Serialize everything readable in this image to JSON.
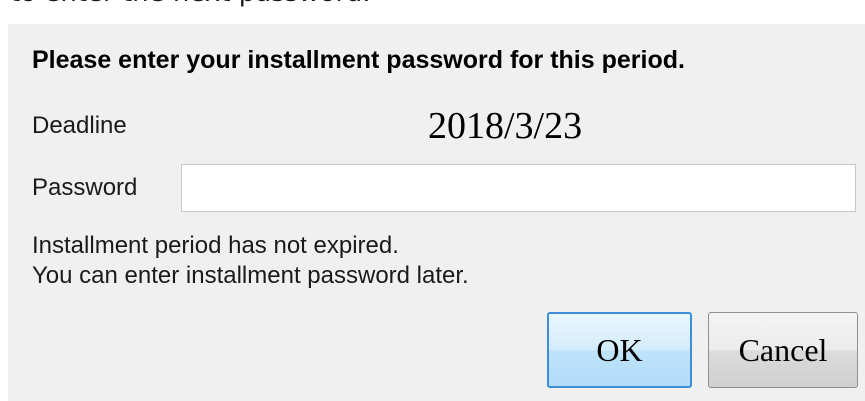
{
  "background_text": "to enter the next password.",
  "dialog": {
    "heading": "Please enter your installment password for this period.",
    "deadline_label": "Deadline",
    "deadline_value": "2018/3/23",
    "password_label": "Password",
    "password_value": "",
    "message_line1": "Installment period has not expired.",
    "message_line2": "You can enter installment password later.",
    "ok_label": "OK",
    "cancel_label": "Cancel"
  },
  "colors": {
    "dialog_background": "#f0f0f0",
    "ok_border": "#3c8fd6"
  }
}
